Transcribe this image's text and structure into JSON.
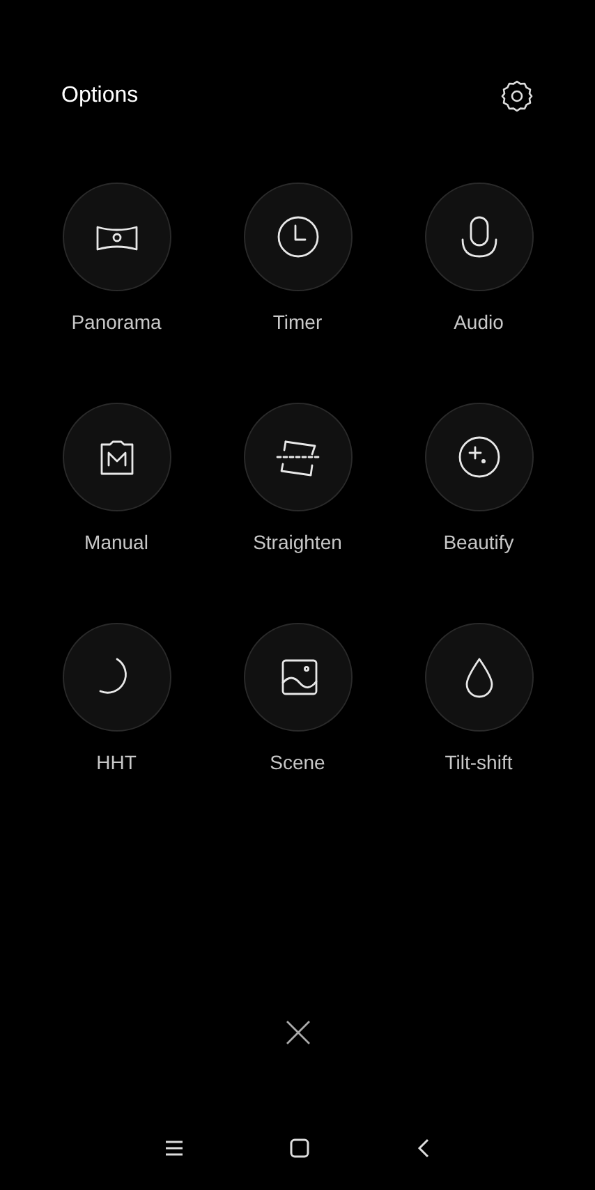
{
  "header": {
    "title": "Options"
  },
  "options": [
    {
      "label": "Panorama"
    },
    {
      "label": "Timer"
    },
    {
      "label": "Audio"
    },
    {
      "label": "Manual"
    },
    {
      "label": "Straighten"
    },
    {
      "label": "Beautify"
    },
    {
      "label": "HHT"
    },
    {
      "label": "Scene"
    },
    {
      "label": "Tilt-shift"
    }
  ]
}
